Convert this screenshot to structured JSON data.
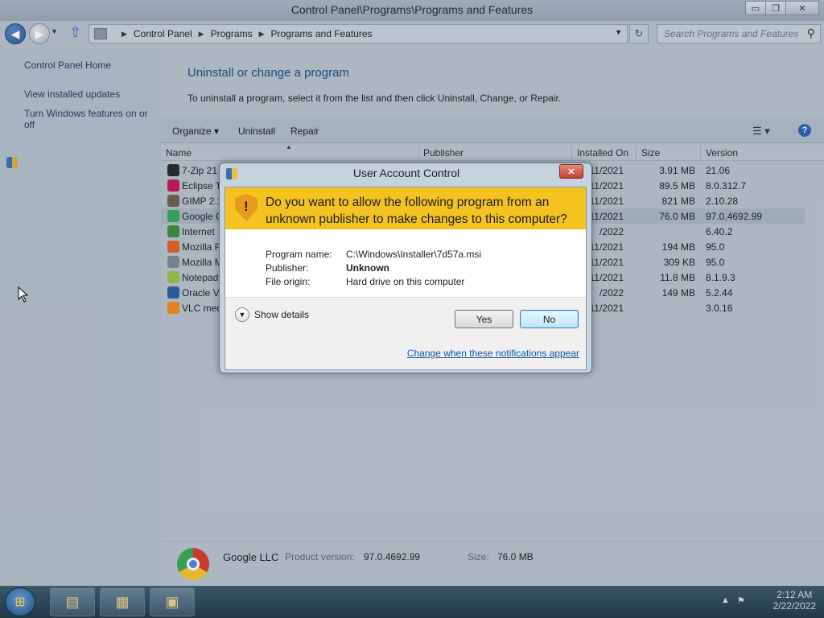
{
  "window": {
    "title": "Control Panel\\Programs\\Programs and Features",
    "controls": {
      "minimize": "▭",
      "maximize": "❐",
      "close": "✕"
    }
  },
  "address": {
    "crumbs": [
      "Control Panel",
      "Programs",
      "Programs and Features"
    ],
    "search_placeholder": "Search Programs and Features"
  },
  "sidebar": {
    "home": "Control Panel Home",
    "updates": "View installed updates",
    "features_line1": "Turn Windows features on or",
    "features_line2": "off"
  },
  "main": {
    "title": "Uninstall or change a program",
    "description": "To uninstall a program, select it from the list and then click Uninstall, Change, or Repair."
  },
  "toolbar": {
    "organize": "Organize ▾",
    "uninstall": "Uninstall",
    "repair": "Repair",
    "help": "?"
  },
  "columns": {
    "name": "Name",
    "publisher": "Publisher",
    "installed_on": "Installed On",
    "size": "Size",
    "version": "Version"
  },
  "programs": [
    {
      "name": "7-Zip 21",
      "date": "11/2021",
      "size": "3.91 MB",
      "version": "21.06",
      "icon_color": "#2b2b2b"
    },
    {
      "name": "Eclipse T",
      "date": "11/2021",
      "size": "89.5 MB",
      "version": "8.0.312.7",
      "icon_color": "#c2185b"
    },
    {
      "name": "GIMP 2.1",
      "date": "11/2021",
      "size": "821 MB",
      "version": "2.10.28",
      "icon_color": "#6d6250"
    },
    {
      "name": "Google C",
      "date": "11/2021",
      "size": "76.0 MB",
      "version": "97.0.4692.99",
      "icon_color": "#3aa757"
    },
    {
      "name": "Internet",
      "date": "/2022",
      "size": "",
      "version": "6.40.2",
      "icon_color": "#3f8f3a"
    },
    {
      "name": "Mozilla F",
      "date": "11/2021",
      "size": "194 MB",
      "version": "95.0",
      "icon_color": "#e0632b"
    },
    {
      "name": "Mozilla M",
      "date": "11/2021",
      "size": "309 KB",
      "version": "95.0",
      "icon_color": "#7d8a96"
    },
    {
      "name": "Notepad",
      "date": "11/2021",
      "size": "11.8 MB",
      "version": "8.1.9.3",
      "icon_color": "#9cc34a"
    },
    {
      "name": "Oracle V",
      "date": "/2022",
      "size": "149 MB",
      "version": "5.2.44",
      "icon_color": "#2f5fa0"
    },
    {
      "name": "VLC med",
      "date": "11/2021",
      "size": "",
      "version": "3.0.16",
      "icon_color": "#f08a1c"
    }
  ],
  "details": {
    "publisher": "Google LLC",
    "product_version_label": "Product version:",
    "product_version": "97.0.4692.99",
    "size_label": "Size:",
    "size": "76.0 MB"
  },
  "uac": {
    "title": "User Account Control",
    "question": "Do you want to allow the following program from an unknown publisher to make changes to this computer?",
    "program_name_label": "Program name:",
    "program_name": "C:\\Windows\\Installer\\7d57a.msi",
    "publisher_label": "Publisher:",
    "publisher": "Unknown",
    "origin_label": "File origin:",
    "origin": "Hard drive on this computer",
    "show_details": "Show details",
    "yes": "Yes",
    "no": "No",
    "change_link": "Change when these notifications appear"
  },
  "taskbar": {
    "time": "2:12 AM",
    "date": "2/22/2022"
  }
}
